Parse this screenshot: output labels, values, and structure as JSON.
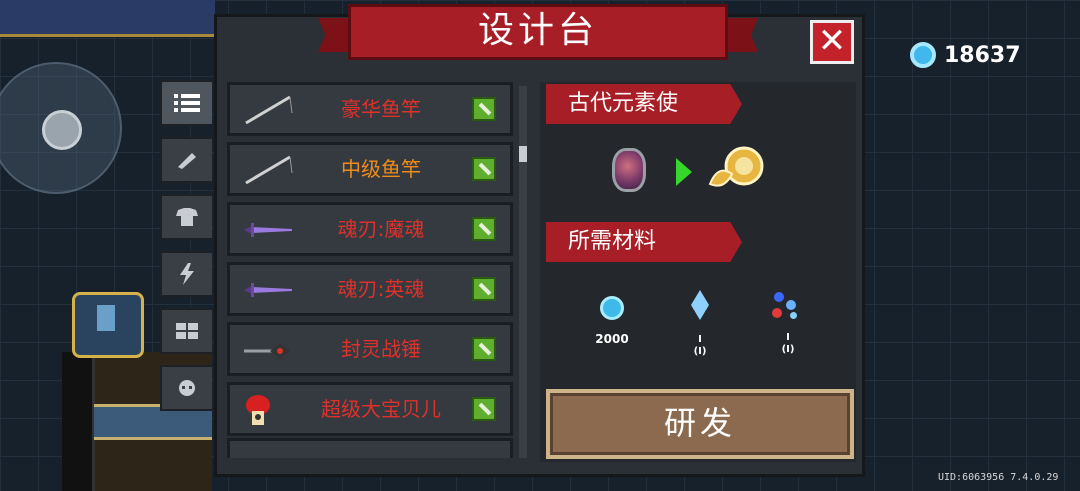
{
  "title": "设计台",
  "close_label": "✕",
  "currency": {
    "icon": "gem-icon",
    "value": "18637"
  },
  "tabs": [
    {
      "name": "list-icon",
      "active": true
    },
    {
      "name": "weapon-icon",
      "active": false
    },
    {
      "name": "armor-icon",
      "active": false
    },
    {
      "name": "skill-icon",
      "active": false
    },
    {
      "name": "blueprint-icon",
      "active": false
    },
    {
      "name": "pet-icon",
      "active": false
    }
  ],
  "items": [
    {
      "label": "豪华鱼竿",
      "color": "#e0302a",
      "icon": "fishing-rod-icon"
    },
    {
      "label": "中级鱼竿",
      "color": "#f08c1a",
      "icon": "fishing-rod-icon"
    },
    {
      "label": "魂刃:魔魂",
      "color": "#e0302a",
      "icon": "sword-icon"
    },
    {
      "label": "魂刃:英魂",
      "color": "#e0302a",
      "icon": "sword-icon"
    },
    {
      "label": "封灵战锤",
      "color": "#e0302a",
      "icon": "hammer-weapon-icon"
    },
    {
      "label": "超级大宝贝儿",
      "color": "#e0302a",
      "icon": "mushroom-icon"
    }
  ],
  "detail": {
    "name": "古代元素使",
    "materials_heading": "所需材料",
    "materials": [
      {
        "icon": "gem-icon",
        "amount": "2000"
      },
      {
        "icon": "crystal-icon",
        "amount": "I\n(I)"
      },
      {
        "icon": "shards-icon",
        "amount": "I\n(I)"
      }
    ],
    "develop_label": "研发"
  },
  "uid": "UID:6063956 7.4.0.29"
}
